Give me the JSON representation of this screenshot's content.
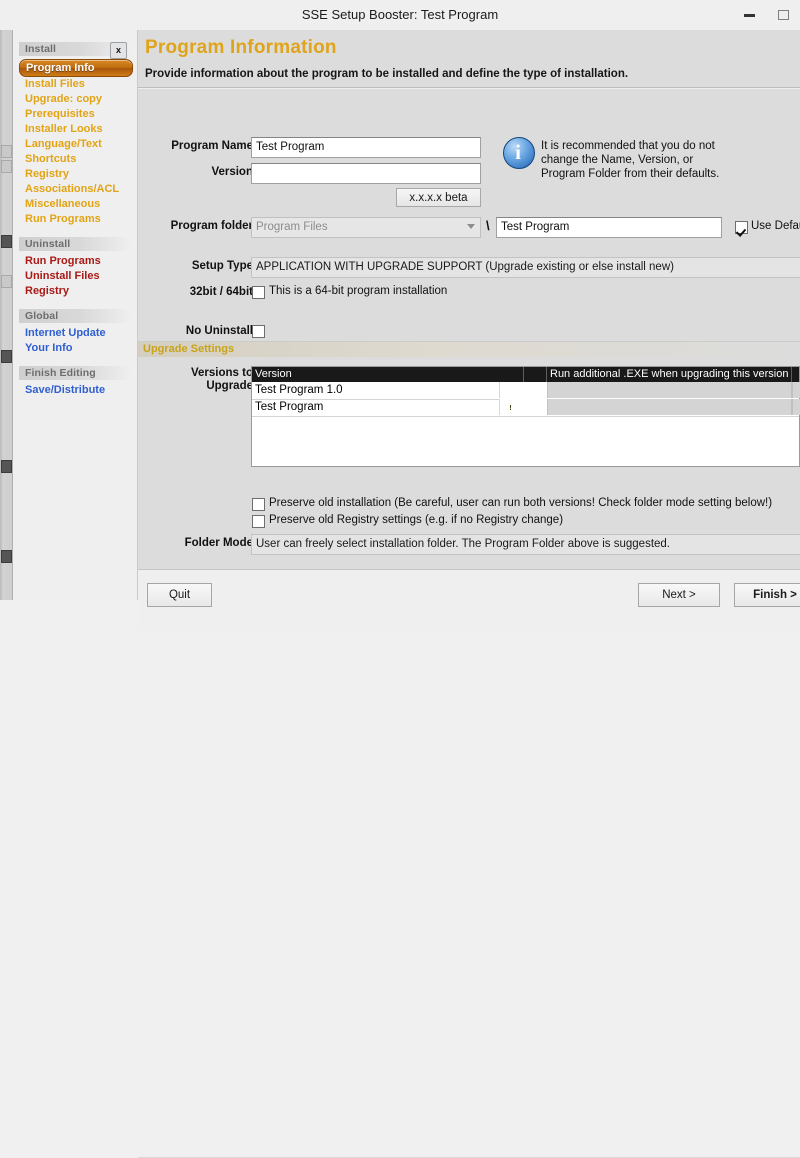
{
  "window": {
    "title": "SSE Setup Booster: Test Program",
    "minimize_icon": "minimize-icon",
    "maximize_icon": "maximize-icon"
  },
  "sidebar": {
    "sections": [
      {
        "header": "Install",
        "kind": "install",
        "items": [
          {
            "label": "Program Info",
            "selected": true
          },
          {
            "label": "Install Files",
            "selected": false
          },
          {
            "label": "Upgrade: copy",
            "selected": false
          },
          {
            "label": "Prerequisites",
            "selected": false
          },
          {
            "label": "Installer Looks",
            "selected": false
          },
          {
            "label": "Language/Text",
            "selected": false
          },
          {
            "label": "Shortcuts",
            "selected": false
          },
          {
            "label": "Registry",
            "selected": false
          },
          {
            "label": "Associations/ACL",
            "selected": false
          },
          {
            "label": "Miscellaneous",
            "selected": false
          },
          {
            "label": "Run Programs",
            "selected": false
          }
        ]
      },
      {
        "header": "Uninstall",
        "kind": "uninstall",
        "items": [
          {
            "label": "Run Programs",
            "selected": false
          },
          {
            "label": "Uninstall Files",
            "selected": false
          },
          {
            "label": "Registry",
            "selected": false
          }
        ]
      },
      {
        "header": "Global",
        "kind": "global",
        "items": [
          {
            "label": "Internet Update",
            "selected": false
          },
          {
            "label": "Your Info",
            "selected": false
          }
        ]
      },
      {
        "header": "Finish Editing",
        "kind": "finish",
        "items": [
          {
            "label": "Save/Distribute",
            "selected": false
          }
        ]
      }
    ]
  },
  "page": {
    "close_panel_label": "x",
    "title": "Program Information",
    "subtitle": "Provide information about the program to be installed and define the type of installation."
  },
  "form": {
    "program_name": {
      "label": "Program Name",
      "value": "Test Program",
      "placeholder": ""
    },
    "version": {
      "label": "Version",
      "value": "",
      "placeholder": ""
    },
    "version_hint_button": "x.x.x.x beta",
    "program_folder": {
      "label": "Program folder",
      "selected_option": "Program Files",
      "separator": "\\",
      "subfolder_value": "Test Program",
      "use_default": {
        "label": "Use Defau",
        "checked": true
      }
    },
    "setup_type": {
      "label": "Setup Type",
      "value": "APPLICATION WITH UPGRADE SUPPORT   (Upgrade existing or else install new)"
    },
    "bitness": {
      "label": "32bit / 64bit",
      "checkbox_label": "This is a 64-bit program installation",
      "checked": false
    },
    "no_uninstall": {
      "label": "No Uninstall",
      "checked": false
    },
    "folder_mode": {
      "label": "Folder Mode",
      "value": "User can freely select installation folder. The Program Folder above is suggested."
    },
    "preserve_install": {
      "label": "Preserve old installation (Be careful, user can run both versions! Check folder mode setting below!)",
      "checked": false
    },
    "preserve_registry": {
      "label": "Preserve old Registry settings (e.g. if no Registry change)",
      "checked": false
    }
  },
  "info_box": {
    "icon": "info-icon",
    "line1": "It is recommended that you do not",
    "line2": "change the Name, Version, or",
    "line3": "Program Folder from their defaults."
  },
  "upgrade_settings": {
    "band_title": "Upgrade Settings",
    "table_label_line1": "Versions to",
    "table_label_line2": "Upgrade",
    "columns": [
      "Version",
      "",
      "Run additional .EXE when upgrading this version",
      ""
    ],
    "rows": [
      {
        "version": "Test Program 1.0",
        "warning": false,
        "exe": ""
      },
      {
        "version": "Test Program",
        "warning": true,
        "exe": ""
      }
    ]
  },
  "footer": {
    "quit": "Quit",
    "next": "Next  >",
    "finish": "Finish  >"
  },
  "colors": {
    "accent_title": "#e0a41b",
    "install_text": "#e2a415",
    "uninstall_text": "#a91916",
    "global_text": "#2f5fd0",
    "selected_pill": "#c06d12",
    "warning": "#f2d024"
  }
}
